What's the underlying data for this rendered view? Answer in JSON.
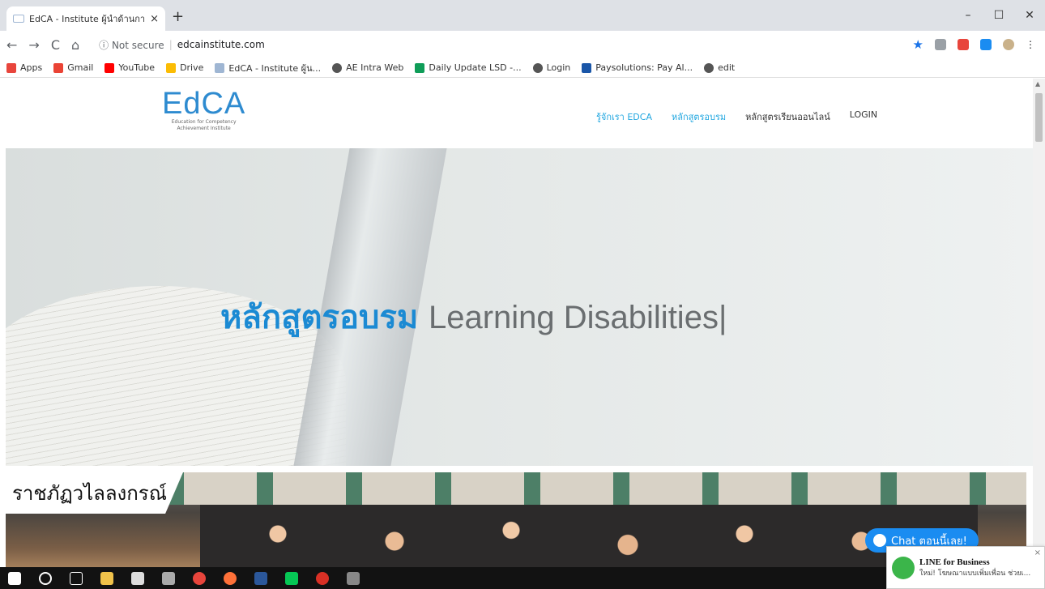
{
  "browser": {
    "tab_title": "EdCA - Institute ผู้นำด้านการถ่ายทอ",
    "tab_close": "×",
    "new_tab": "+",
    "window_controls": [
      "–",
      "☐",
      "✕"
    ],
    "back": "←",
    "forward": "→",
    "reload": "C",
    "home": "⌂",
    "security": "ⓘ Not secure",
    "separator": "|",
    "url": "edcainstitute.com",
    "bookmarks": [
      {
        "label": "Apps",
        "icon": "apps-grid-icon",
        "color": "#e8453c"
      },
      {
        "label": "Gmail",
        "icon": "gmail-icon",
        "color": "#ea4335"
      },
      {
        "label": "YouTube",
        "icon": "youtube-icon",
        "color": "#ff0000"
      },
      {
        "label": "Drive",
        "icon": "drive-icon",
        "color": "#fbbc04"
      },
      {
        "label": "EdCA - Institute ผู้น...",
        "icon": "edca-icon",
        "color": "#9fb6d3"
      },
      {
        "label": "AE Intra Web",
        "icon": "globe-icon",
        "color": "#555555"
      },
      {
        "label": "Daily Update LSD -...",
        "icon": "sheets-icon",
        "color": "#0f9d58"
      },
      {
        "label": "Login",
        "icon": "globe-icon",
        "color": "#555555"
      },
      {
        "label": "Paysolutions: Pay Al...",
        "icon": "paysolutions-icon",
        "color": "#1a56a8"
      },
      {
        "label": "edit",
        "icon": "globe-icon",
        "color": "#555555"
      }
    ]
  },
  "site": {
    "logo_text": "EdCA",
    "logo_sub1": "Education for Competency",
    "logo_sub2": "Achievement Institute",
    "menu": [
      {
        "label": "รู้จักเรา EDCA",
        "active": true
      },
      {
        "label": "หลักสูตรอบรม",
        "active": true
      },
      {
        "label": "หลักสูตรเรียนออนไลน์",
        "active": false
      },
      {
        "label": "LOGIN",
        "active": false
      }
    ],
    "hero_thai": "หลักสูตรอบรม",
    "hero_english": "Learning Disabilities|",
    "photo_tag": "ราชภัฏวไลลงกรณ์",
    "chat_button": "Chat ตอนนี้เลย!"
  },
  "notification": {
    "title": "LINE for Business",
    "body": "ใหม่! โฆษณาแบบเพิ่มเพื่อน ช่วยเ...",
    "close": "×"
  },
  "colors": {
    "accent": "#22a7e0",
    "hero_blue": "#1b8ad3",
    "chat_blue": "#1a8cf1"
  }
}
